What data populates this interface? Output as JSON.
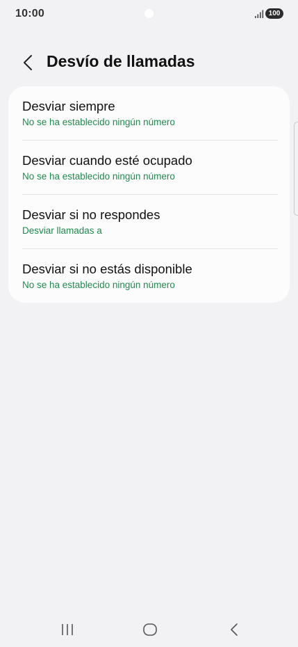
{
  "status_bar": {
    "time": "10:00",
    "battery": "100"
  },
  "header": {
    "back_icon": "chevron-left-icon",
    "title": "Desvío de llamadas"
  },
  "forwarding_options": [
    {
      "title": "Desviar siempre",
      "subtitle": "No se ha establecido ningún número"
    },
    {
      "title": "Desviar cuando esté ocupado",
      "subtitle": "No se ha establecido ningún número"
    },
    {
      "title": "Desviar si no respondes",
      "subtitle": "Desviar llamadas a"
    },
    {
      "title": "Desviar si no estás disponible",
      "subtitle": "No se ha establecido ningún número"
    }
  ],
  "colors": {
    "background": "#f2f2f4",
    "card": "#fcfcfd",
    "accent_green": "#1f8a4c",
    "text": "#111111"
  },
  "nav_bar": {
    "recents_icon": "recents-icon",
    "home_icon": "home-icon",
    "back_icon": "back-icon"
  }
}
